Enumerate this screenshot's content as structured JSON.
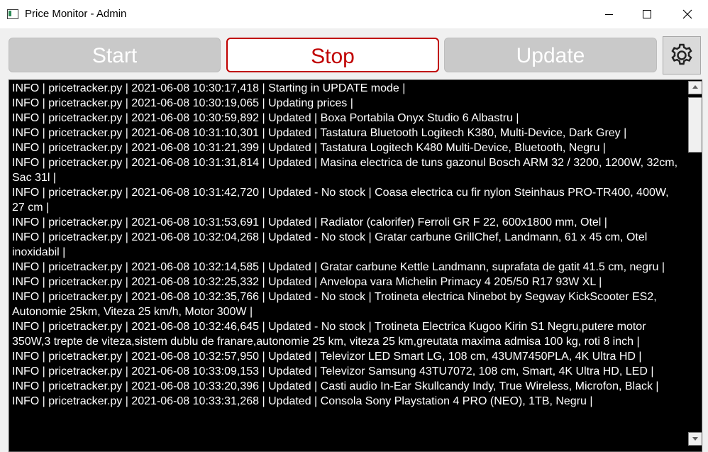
{
  "window": {
    "title": "Price Monitor - Admin",
    "icons": {
      "app": "window-icon",
      "minimize": "minimize-icon",
      "maximize": "maximize-icon",
      "close": "close-icon"
    }
  },
  "toolbar": {
    "start_label": "Start",
    "stop_label": "Stop",
    "update_label": "Update",
    "settings_icon": "gear-icon",
    "colors": {
      "stop_accent": "#c00000",
      "disabled_bg": "#c9c9c9"
    }
  },
  "log": {
    "background": "#000000",
    "foreground": "#ffffff",
    "lines": [
      "INFO | pricetracker.py | 2021-06-08 10:30:17,418 | Starting in UPDATE mode |",
      "INFO | pricetracker.py | 2021-06-08 10:30:19,065 | Updating prices |",
      "INFO | pricetracker.py | 2021-06-08 10:30:59,892 | Updated | Boxa Portabila Onyx Studio 6 Albastru |",
      "INFO | pricetracker.py | 2021-06-08 10:31:10,301 | Updated | Tastatura Bluetooth Logitech K380, Multi-Device, Dark Grey |",
      "INFO | pricetracker.py | 2021-06-08 10:31:21,399 | Updated | Tastatura Logitech K480 Multi-Device, Bluetooth, Negru |",
      "INFO | pricetracker.py | 2021-06-08 10:31:31,814 | Updated | Masina electrica de tuns gazonul Bosch ARM 32 / 3200, 1200W, 32cm, Sac 31l |",
      "INFO | pricetracker.py | 2021-06-08 10:31:42,720 | Updated - No stock | Coasa electrica cu fir nylon Steinhaus PRO-TR400, 400W, 27 cm |",
      "INFO | pricetracker.py | 2021-06-08 10:31:53,691 | Updated | Radiator (calorifer) Ferroli GR F 22, 600x1800 mm, Otel |",
      "INFO | pricetracker.py | 2021-06-08 10:32:04,268 | Updated - No stock | Gratar carbune GrillChef, Landmann, 61 x 45 cm, Otel inoxidabil |",
      "INFO | pricetracker.py | 2021-06-08 10:32:14,585 | Updated | Gratar carbune Kettle Landmann, suprafata de gatit 41.5 cm, negru |",
      "INFO | pricetracker.py | 2021-06-08 10:32:25,332 | Updated | Anvelopa vara Michelin Primacy 4 205/50 R17 93W XL |",
      "INFO | pricetracker.py | 2021-06-08 10:32:35,766 | Updated - No stock | Trotineta electrica Ninebot by Segway KickScooter ES2, Autonomie 25km, Viteza 25 km/h, Motor 300W |",
      "INFO | pricetracker.py | 2021-06-08 10:32:46,645 | Updated - No stock | Trotineta Electrica Kugoo Kirin S1 Negru,putere motor 350W,3 trepte de viteza,sistem dublu de franare,autonomie 25 km, viteza 25 km,greutata maxima admisa 100 kg, roti 8 inch |",
      "INFO | pricetracker.py | 2021-06-08 10:32:57,950 | Updated | Televizor LED Smart LG, 108 cm, 43UM7450PLA, 4K Ultra HD |",
      "INFO | pricetracker.py | 2021-06-08 10:33:09,153 | Updated | Televizor Samsung 43TU7072, 108 cm, Smart, 4K Ultra HD, LED |",
      "INFO | pricetracker.py | 2021-06-08 10:33:20,396 | Updated | Casti audio In-Ear Skullcandy Indy, True Wireless, Microfon, Black |",
      "INFO | pricetracker.py | 2021-06-08 10:33:31,268 | Updated | Consola Sony Playstation 4 PRO (NEO), 1TB, Negru |"
    ]
  }
}
